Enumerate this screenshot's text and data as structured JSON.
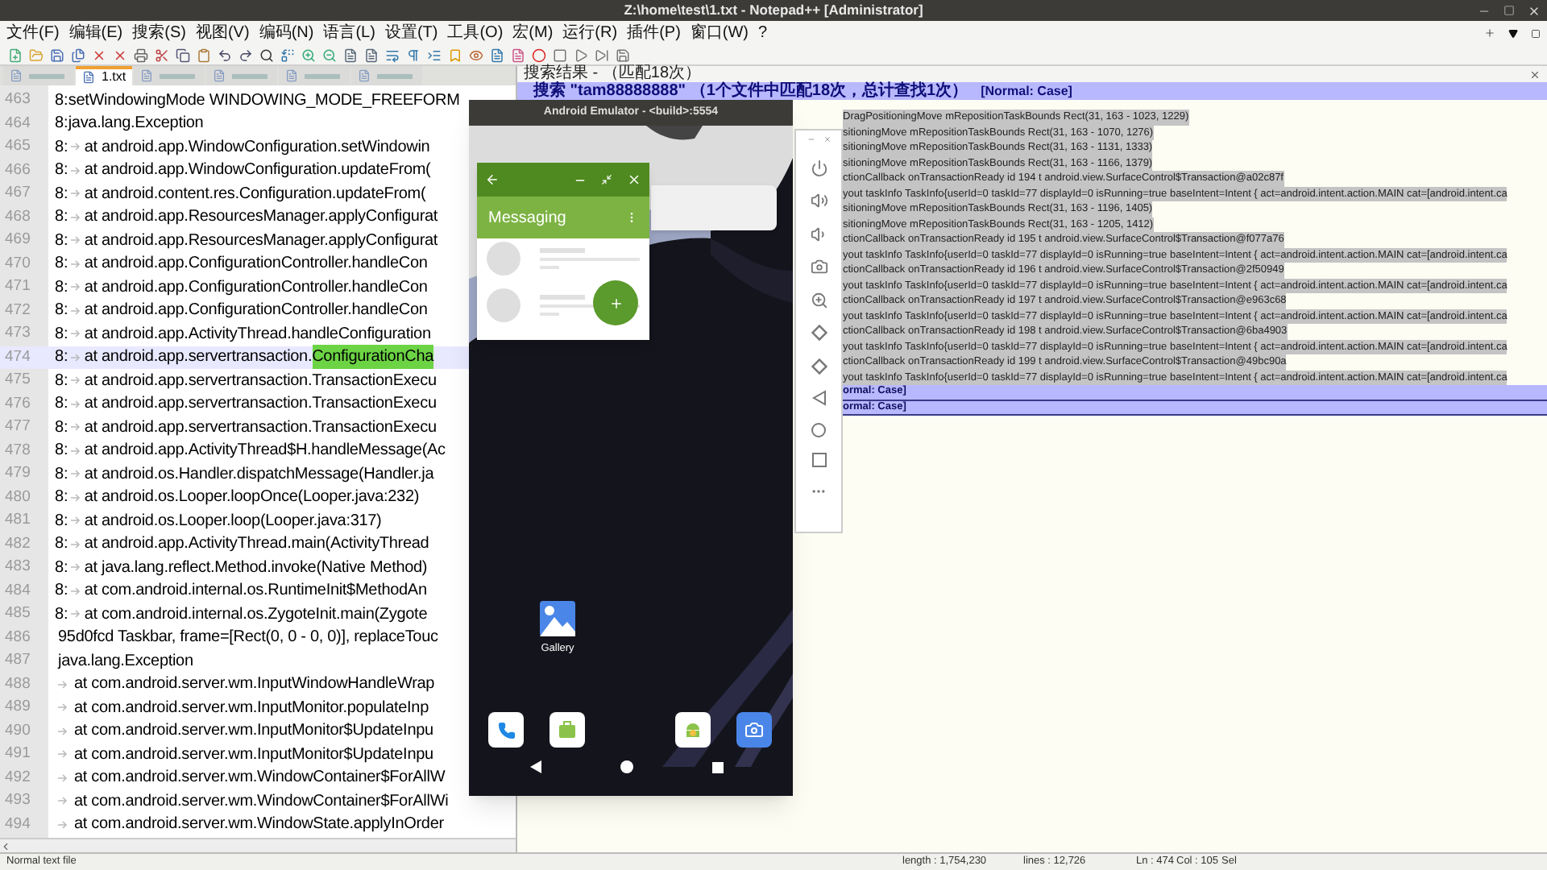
{
  "window": {
    "title": "Z:\\home\\test\\1.txt - Notepad++ [Administrator]"
  },
  "menu": [
    "文件(F)",
    "编辑(E)",
    "搜索(S)",
    "视图(V)",
    "编码(N)",
    "语言(L)",
    "设置(T)",
    "工具(O)",
    "宏(M)",
    "运行(R)",
    "插件(P)",
    "窗口(W)",
    "?"
  ],
  "tabs": [
    {
      "selected": false
    },
    {
      "label": "1.txt",
      "selected": true
    },
    {
      "selected": false
    },
    {
      "selected": false
    },
    {
      "selected": false
    },
    {
      "selected": false
    }
  ],
  "editor": {
    "lines": [
      {
        "num": "463",
        "prefix": "8:",
        "indent": false,
        "text": "setWindowingMode WINDOWING_MODE_FREEFORM",
        "current": false
      },
      {
        "num": "464",
        "prefix": "8:",
        "indent": false,
        "text": "java.lang.Exception",
        "current": false
      },
      {
        "num": "465",
        "prefix": "8:",
        "indent": true,
        "text": "at android.app.WindowConfiguration.setWindowin",
        "current": false
      },
      {
        "num": "466",
        "prefix": "8:",
        "indent": true,
        "text": "at android.app.WindowConfiguration.updateFrom(",
        "current": false
      },
      {
        "num": "467",
        "prefix": "8:",
        "indent": true,
        "text": "at android.content.res.Configuration.updateFrom(",
        "current": false
      },
      {
        "num": "468",
        "prefix": "8:",
        "indent": true,
        "text": "at android.app.ResourcesManager.applyConfigurat",
        "current": false
      },
      {
        "num": "469",
        "prefix": "8:",
        "indent": true,
        "text": "at android.app.ResourcesManager.applyConfigurat",
        "current": false
      },
      {
        "num": "470",
        "prefix": "8:",
        "indent": true,
        "text": "at android.app.ConfigurationController.handleCon",
        "current": false
      },
      {
        "num": "471",
        "prefix": "8:",
        "indent": true,
        "text": "at android.app.ConfigurationController.handleCon",
        "current": false
      },
      {
        "num": "472",
        "prefix": "8:",
        "indent": true,
        "text": "at android.app.ConfigurationController.handleCon",
        "current": false
      },
      {
        "num": "473",
        "prefix": "8:",
        "indent": true,
        "text": "at android.app.ActivityThread.handleConfiguration",
        "current": false
      },
      {
        "num": "474",
        "prefix": "8:",
        "indent": true,
        "text": "at android.app.servertransaction.",
        "match": "ConfigurationCha",
        "current": true
      },
      {
        "num": "475",
        "prefix": "8:",
        "indent": true,
        "text": "at android.app.servertransaction.TransactionExecu",
        "current": false
      },
      {
        "num": "476",
        "prefix": "8:",
        "indent": true,
        "text": "at android.app.servertransaction.TransactionExecu",
        "current": false
      },
      {
        "num": "477",
        "prefix": "8:",
        "indent": true,
        "text": "at android.app.servertransaction.TransactionExecu",
        "current": false
      },
      {
        "num": "478",
        "prefix": "8:",
        "indent": true,
        "text": "at android.app.ActivityThread$H.handleMessage(Ac",
        "current": false
      },
      {
        "num": "479",
        "prefix": "8:",
        "indent": true,
        "text": "at android.os.Handler.dispatchMessage(Handler.ja",
        "current": false
      },
      {
        "num": "480",
        "prefix": "8:",
        "indent": true,
        "text": "at android.os.Looper.loopOnce(Looper.java:232)",
        "current": false
      },
      {
        "num": "481",
        "prefix": "8:",
        "indent": true,
        "text": "at android.os.Looper.loop(Looper.java:317)",
        "current": false
      },
      {
        "num": "482",
        "prefix": "8:",
        "indent": true,
        "text": "at android.app.ActivityThread.main(ActivityThread",
        "current": false
      },
      {
        "num": "483",
        "prefix": "8:",
        "indent": true,
        "text": "at java.lang.reflect.Method.invoke(Native Method)",
        "current": false
      },
      {
        "num": "484",
        "prefix": "8:",
        "indent": true,
        "text": "at com.android.internal.os.RuntimeInit$MethodAn",
        "current": false
      },
      {
        "num": "485",
        "prefix": "8:",
        "indent": true,
        "text": "at com.android.internal.os.ZygoteInit.main(Zygote",
        "current": false
      },
      {
        "num": "486",
        "indent": false,
        "text": "95d0fcd Taskbar, frame=[Rect(0, 0 - 0, 0)], replaceTouc",
        "current": false
      },
      {
        "num": "487",
        "indent": false,
        "text": "java.lang.Exception",
        "current": false
      },
      {
        "num": "488",
        "indent": true,
        "text": "at com.android.server.wm.InputWindowHandleWrap",
        "current": false
      },
      {
        "num": "489",
        "indent": true,
        "text": "at com.android.server.wm.InputMonitor.populateInp",
        "current": false
      },
      {
        "num": "490",
        "indent": true,
        "text": "at com.android.server.wm.InputMonitor$UpdateInpu",
        "current": false
      },
      {
        "num": "491",
        "indent": true,
        "text": "at com.android.server.wm.InputMonitor$UpdateInpu",
        "current": false
      },
      {
        "num": "492",
        "indent": true,
        "text": "at com.android.server.wm.WindowContainer$ForAllW",
        "current": false
      },
      {
        "num": "493",
        "indent": true,
        "text": "at com.android.server.wm.WindowContainer$ForAllWi",
        "current": false
      },
      {
        "num": "494",
        "indent": true,
        "text": "at com.android.server.wm.WindowState.applyInOrder",
        "current": false
      }
    ]
  },
  "search_results": {
    "title": "搜索结果 - （匹配18次）",
    "summary": "搜索 \"tam88888888\" （1个文件中匹配18次，总计查找1次）",
    "flags": "[Normal: Case]",
    "rows": [
      {
        "kind": "match",
        "text": "DragPositioningMove mRepositionTaskBounds  Rect(31, 163 - 1023, 1229)"
      },
      {
        "kind": "match",
        "text": "sitioningMove mRepositionTaskBounds  Rect(31, 163 - 1070, 1276)"
      },
      {
        "kind": "match",
        "text": "sitioningMove mRepositionTaskBounds  Rect(31, 163 - 1131, 1333)"
      },
      {
        "kind": "match",
        "text": "sitioningMove mRepositionTaskBounds  Rect(31, 163 - 1166, 1379)"
      },
      {
        "kind": "match",
        "text": "ctionCallback onTransactionReady id 194 t android.view.SurfaceControl$Transaction@a02c87f"
      },
      {
        "kind": "match",
        "text": "yout taskInfo TaskInfo{userId=0 taskId=77 displayId=0 isRunning=true baseIntent=Intent { act=android.intent.action.MAIN cat=[android.intent.ca"
      },
      {
        "kind": "match",
        "text": "sitioningMove mRepositionTaskBounds  Rect(31, 163 - 1196, 1405)"
      },
      {
        "kind": "match",
        "text": "sitioningMove mRepositionTaskBounds  Rect(31, 163 - 1205, 1412)"
      },
      {
        "kind": "match",
        "text": "ctionCallback onTransactionReady id 195 t android.view.SurfaceControl$Transaction@f077a76"
      },
      {
        "kind": "match",
        "text": "yout taskInfo TaskInfo{userId=0 taskId=77 displayId=0 isRunning=true baseIntent=Intent { act=android.intent.action.MAIN cat=[android.intent.ca"
      },
      {
        "kind": "match",
        "text": "ctionCallback onTransactionReady id 196 t android.view.SurfaceControl$Transaction@2f50949"
      },
      {
        "kind": "match",
        "text": "yout taskInfo TaskInfo{userId=0 taskId=77 displayId=0 isRunning=true baseIntent=Intent { act=android.intent.action.MAIN cat=[android.intent.ca"
      },
      {
        "kind": "match",
        "text": "ctionCallback onTransactionReady id 197 t android.view.SurfaceControl$Transaction@e963c68"
      },
      {
        "kind": "match",
        "text": "yout taskInfo TaskInfo{userId=0 taskId=77 displayId=0 isRunning=true baseIntent=Intent { act=android.intent.action.MAIN cat=[android.intent.ca"
      },
      {
        "kind": "match",
        "text": "ctionCallback onTransactionReady id 198 t android.view.SurfaceControl$Transaction@6ba4903"
      },
      {
        "kind": "match",
        "text": "yout taskInfo TaskInfo{userId=0 taskId=77 displayId=0 isRunning=true baseIntent=Intent { act=android.intent.action.MAIN cat=[android.intent.ca"
      },
      {
        "kind": "match",
        "text": "ctionCallback onTransactionReady id 199 t android.view.SurfaceControl$Transaction@49bc90a"
      },
      {
        "kind": "match",
        "text": "yout taskInfo TaskInfo{userId=0 taskId=77 displayId=0 isRunning=true baseIntent=Intent { act=android.intent.action.MAIN cat=[android.intent.ca"
      },
      {
        "kind": "search",
        "text": "ormal: Case]"
      },
      {
        "kind": "search",
        "text": "ormal: Case]"
      }
    ]
  },
  "status_bar": {
    "file_type": "Normal text file",
    "length": "length : 1,754,230",
    "lines": "lines : 12,726",
    "ln": "Ln : 474",
    "col": "Col : 105",
    "sel": "Sel"
  },
  "emulator": {
    "title": "Android Emulator - <build>:5554",
    "freeform_window": {
      "app_title": "Messaging"
    },
    "home": {
      "gallery_label": "Gallery"
    }
  }
}
